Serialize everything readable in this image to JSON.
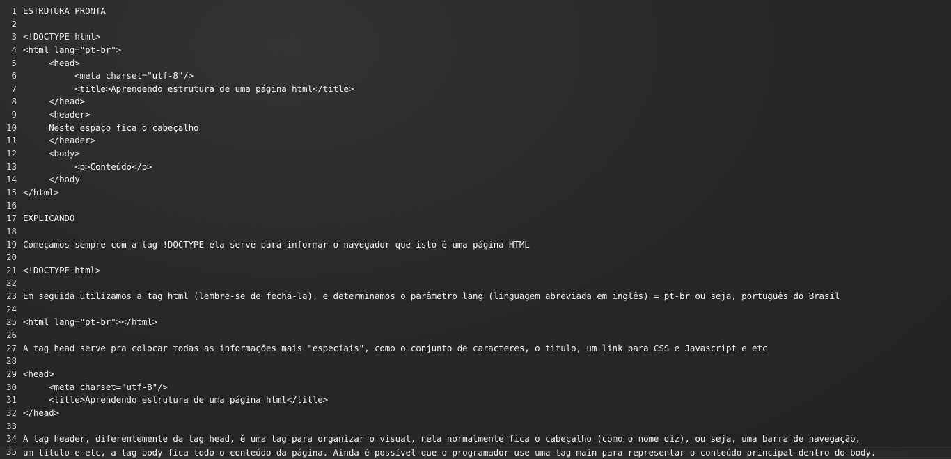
{
  "editor": {
    "lines": [
      {
        "n": "1",
        "text": "ESTRUTURA PRONTA"
      },
      {
        "n": "2",
        "text": ""
      },
      {
        "n": "3",
        "text": "<!DOCTYPE html>"
      },
      {
        "n": "4",
        "text": "<html lang=\"pt-br\">"
      },
      {
        "n": "5",
        "text": "     <head>"
      },
      {
        "n": "6",
        "text": "          <meta charset=\"utf-8\"/>"
      },
      {
        "n": "7",
        "text": "          <title>Aprendendo estrutura de uma página html</title>"
      },
      {
        "n": "8",
        "text": "     </head>"
      },
      {
        "n": "9",
        "text": "     <header>"
      },
      {
        "n": "10",
        "text": "     Neste espaço fica o cabeçalho"
      },
      {
        "n": "11",
        "text": "     </header>"
      },
      {
        "n": "12",
        "text": "     <body>"
      },
      {
        "n": "13",
        "text": "          <p>Conteúdo</p>"
      },
      {
        "n": "14",
        "text": "     </body"
      },
      {
        "n": "15",
        "text": "</html>"
      },
      {
        "n": "16",
        "text": ""
      },
      {
        "n": "17",
        "text": "EXPLICANDO"
      },
      {
        "n": "18",
        "text": ""
      },
      {
        "n": "19",
        "text": "Começamos sempre com a tag !DOCTYPE ela serve para informar o navegador que isto é uma página HTML"
      },
      {
        "n": "20",
        "text": ""
      },
      {
        "n": "21",
        "text": "<!DOCTYPE html>"
      },
      {
        "n": "22",
        "text": ""
      },
      {
        "n": "23",
        "text": "Em seguida utilizamos a tag html (lembre-se de fechá-la), e determinamos o parâmetro lang (linguagem abreviada em inglês) = pt-br ou seja, português do Brasil"
      },
      {
        "n": "24",
        "text": ""
      },
      {
        "n": "25",
        "text": "<html lang=\"pt-br\"></html>"
      },
      {
        "n": "26",
        "text": ""
      },
      {
        "n": "27",
        "text": "A tag head serve pra colocar todas as informações mais \"especiais\", como o conjunto de caracteres, o titulo, um link para CSS e Javascript e etc"
      },
      {
        "n": "28",
        "text": ""
      },
      {
        "n": "29",
        "text": "<head>"
      },
      {
        "n": "30",
        "text": "     <meta charset=\"utf-8\"/>"
      },
      {
        "n": "31",
        "text": "     <title>Aprendendo estrutura de uma página html</title>"
      },
      {
        "n": "32",
        "text": "</head>"
      },
      {
        "n": "33",
        "text": ""
      },
      {
        "n": "34",
        "text": "A tag header, diferentemente da tag head, é uma tag para organizar o visual, nela normalmente fica o cabeçalho (como o nome diz), ou seja, uma barra de navegação,"
      },
      {
        "n": "",
        "text": "um título e etc, a tag body fica todo o conteúdo da página. Ainda é possível que o programador use uma tag main para representar o conteúdo principal dentro do body."
      },
      {
        "n": "35",
        "text": ""
      }
    ]
  }
}
